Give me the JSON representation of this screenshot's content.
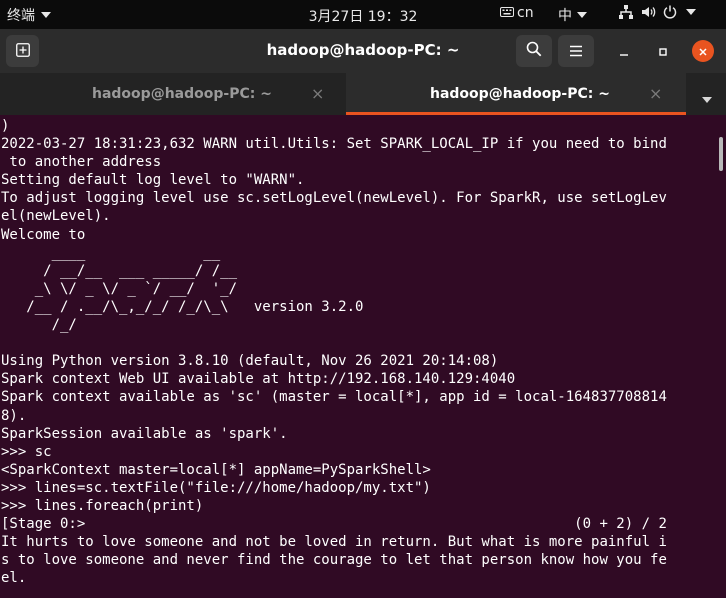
{
  "system_bar": {
    "app_name": "终端",
    "clock": "3月27日 19：32",
    "keyboard_layout": "cn",
    "input_method": "中"
  },
  "window": {
    "title": "hadoop@hadoop-PC: ~"
  },
  "tabs": [
    {
      "label": "hadoop@hadoop-PC: ~",
      "close": "×",
      "active": false
    },
    {
      "label": "hadoop@hadoop-PC: ~",
      "close": "×",
      "active": true
    }
  ],
  "terminal": {
    "lines": [
      ")",
      "2022-03-27 18:31:23,632 WARN util.Utils: Set SPARK_LOCAL_IP if you need to bind",
      " to another address",
      "Setting default log level to \"WARN\".",
      "To adjust logging level use sc.setLogLevel(newLevel). For SparkR, use setLogLev",
      "el(newLevel).",
      "Welcome to",
      "      ____              __",
      "     / __/__  ___ _____/ /__",
      "    _\\ \\/ _ \\/ _ `/ __/  '_/",
      "   /__ / .__/\\_,_/_/ /_/\\_\\   version 3.2.0",
      "      /_/",
      "",
      "Using Python version 3.8.10 (default, Nov 26 2021 20:14:08)",
      "Spark context Web UI available at http://192.168.140.129:4040",
      "Spark context available as 'sc' (master = local[*], app id = local-164837708814",
      "8).",
      "SparkSession available as 'spark'.",
      ">>> sc",
      "<SparkContext master=local[*] appName=PySparkShell>",
      ">>> lines=sc.textFile(\"file:///home/hadoop/my.txt\")",
      ">>> lines.foreach(print)",
      "[Stage 0:>                                                          (0 + 2) / 2",
      "It hurts to love someone and not be loved in return. But what is more painful i",
      "s to love someone and never find the courage to let that person know how you fe",
      "el."
    ]
  },
  "colors": {
    "terminal_bg": "#300a24",
    "accent": "#e95420",
    "titlebar_bg": "#2c2c2c",
    "topbar_bg": "#0b0b0b"
  }
}
